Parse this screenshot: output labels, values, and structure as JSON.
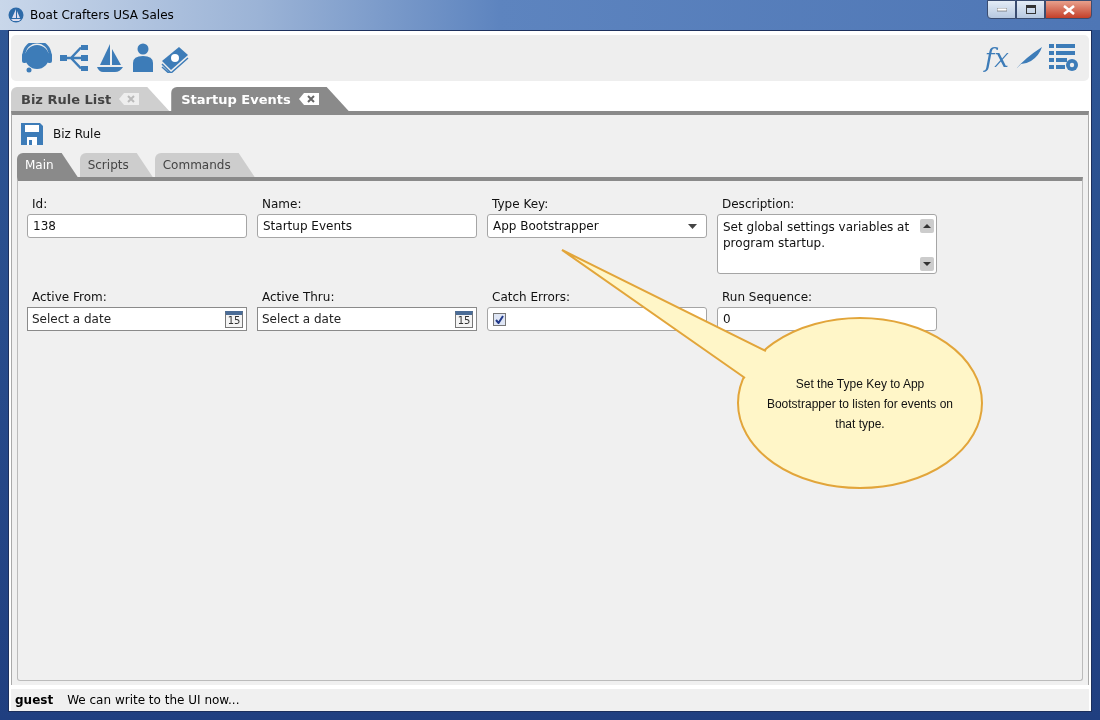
{
  "window": {
    "title": "Boat Crafters USA Sales"
  },
  "toolbar": {
    "function_label": "fx"
  },
  "tabs": [
    {
      "label": "Biz Rule List",
      "selected": false
    },
    {
      "label": "Startup Events",
      "selected": true
    }
  ],
  "document": {
    "title": "Biz Rule"
  },
  "subtabs": [
    {
      "label": "Main",
      "selected": true
    },
    {
      "label": "Scripts",
      "selected": false
    },
    {
      "label": "Commands",
      "selected": false
    }
  ],
  "fields": [
    {
      "kind": "text",
      "label": "Id:",
      "value": "138"
    },
    {
      "kind": "text",
      "label": "Name:",
      "value": "Startup Events"
    },
    {
      "kind": "dropdown",
      "label": "Type Key:",
      "value": "App Bootstrapper"
    },
    {
      "kind": "textarea",
      "label": "Description:",
      "value": "Set global settings variables at program startup."
    },
    {
      "kind": "date",
      "label": "Active From:",
      "placeholder": "Select a date",
      "calendar_day": "15"
    },
    {
      "kind": "date",
      "label": "Active Thru:",
      "placeholder": "Select a date",
      "calendar_day": "15"
    },
    {
      "kind": "checkbox",
      "label": "Catch Errors:",
      "checked": true
    },
    {
      "kind": "text",
      "label": "Run Sequence:",
      "value": "0"
    }
  ],
  "callout": {
    "text": "Set the Type Key to App Bootstrapper to listen for events on that type."
  },
  "status_bar": {
    "user": "guest",
    "message": "We can write to the UI now..."
  }
}
